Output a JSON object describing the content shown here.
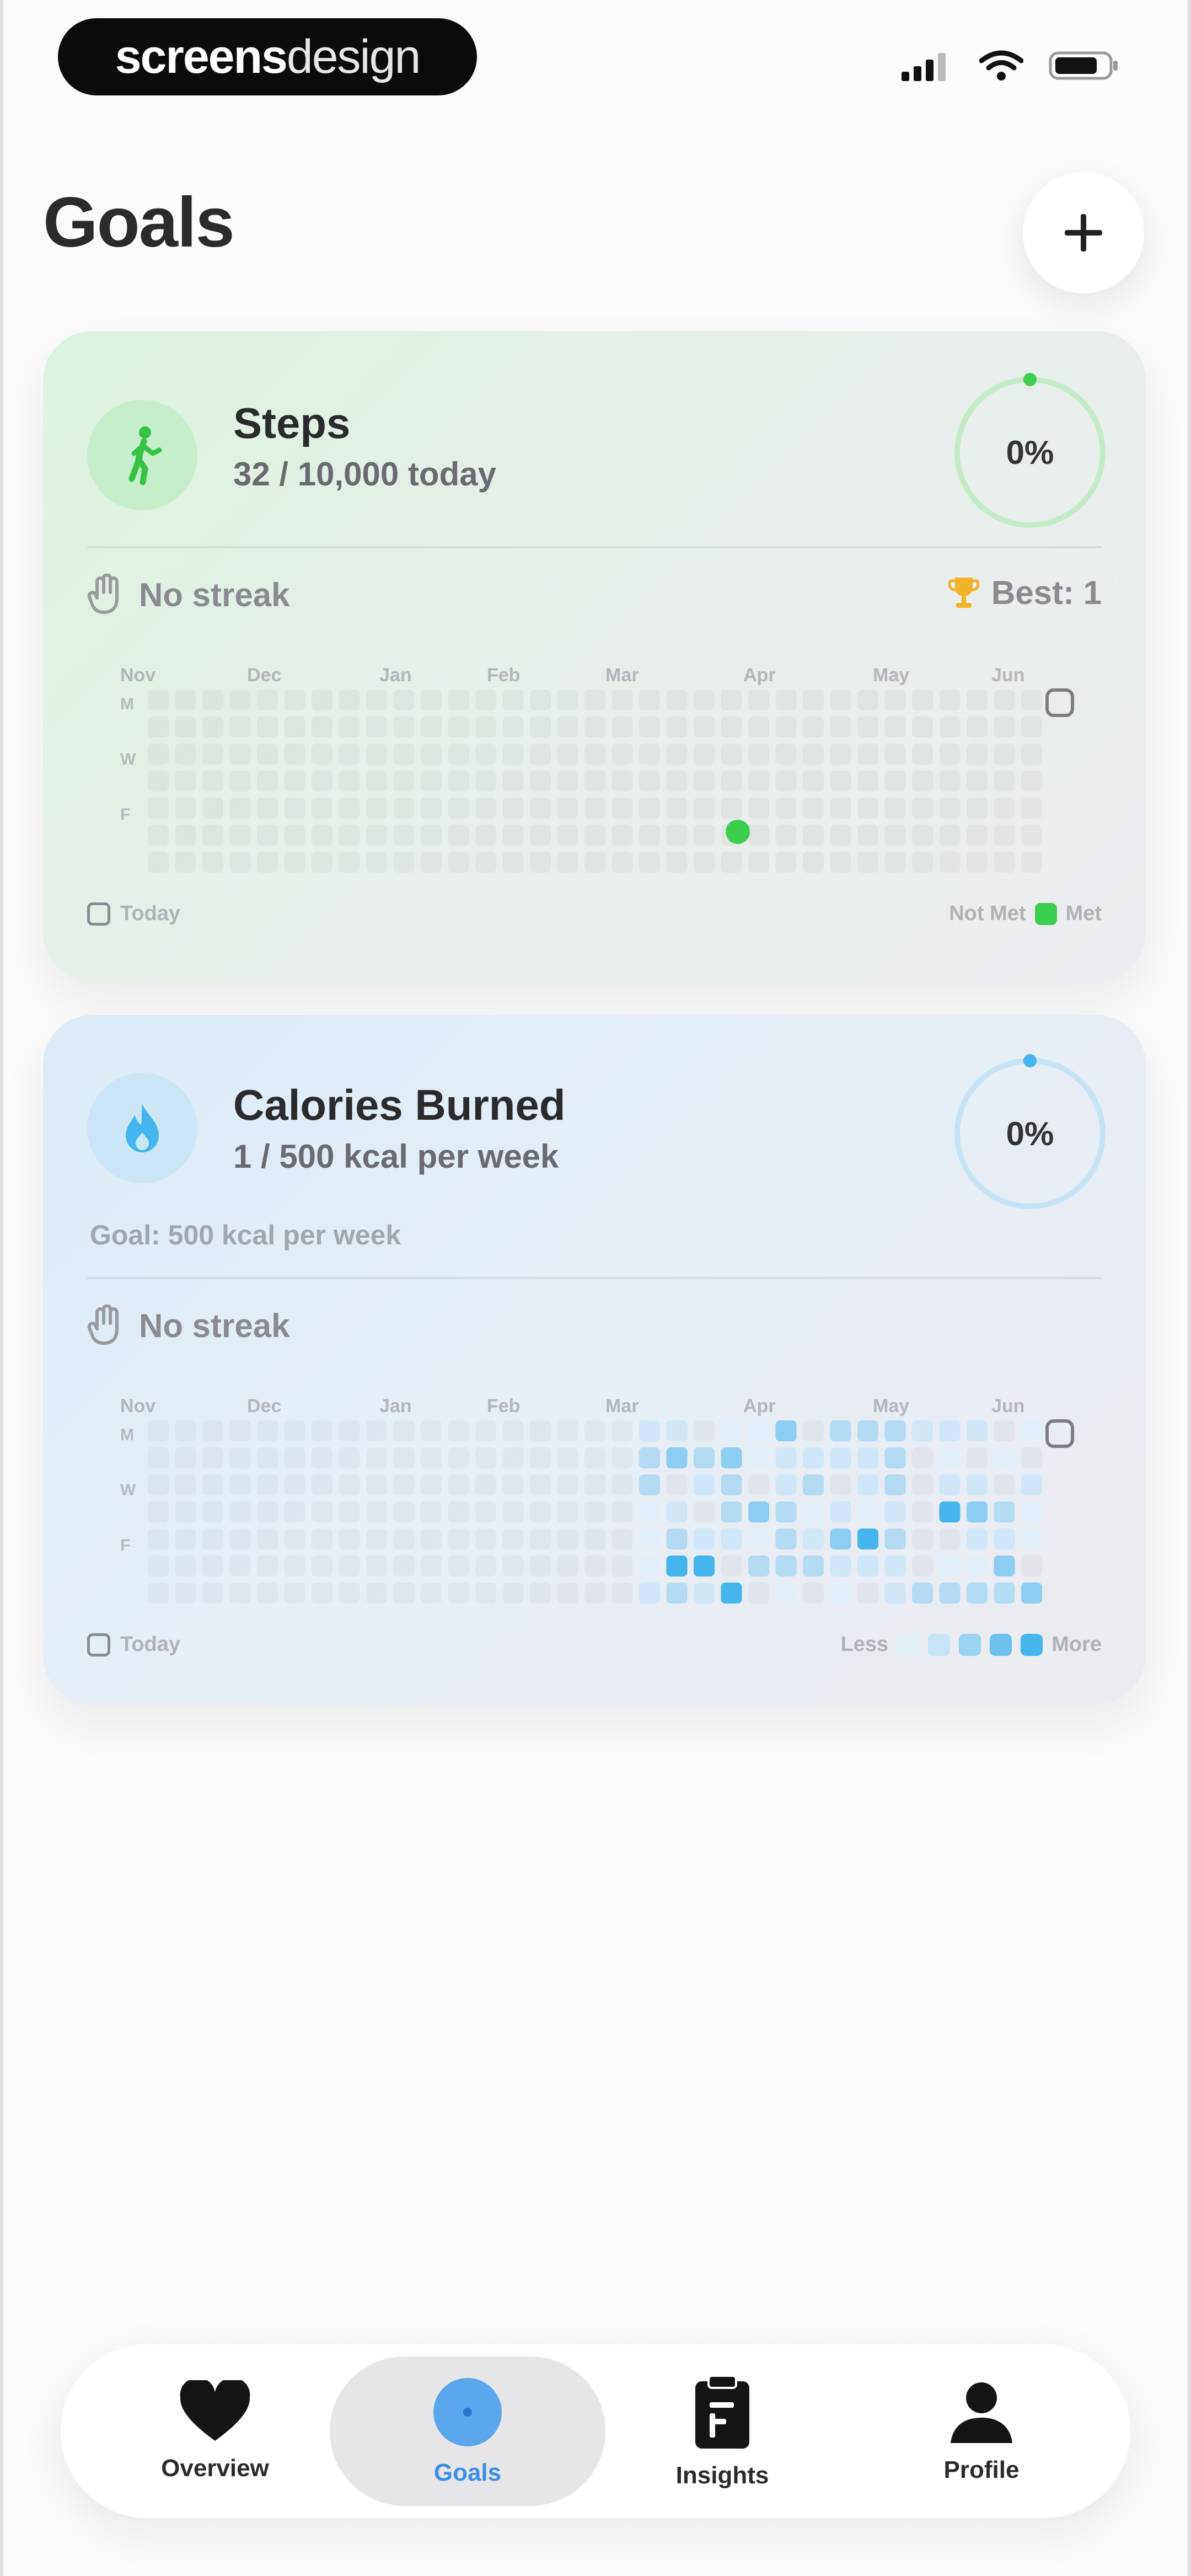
{
  "status_bar": {
    "brand_left": "screens",
    "brand_right": "design"
  },
  "header": {
    "title": "Goals",
    "add_icon": "plus-icon"
  },
  "goals": [
    {
      "title": "Steps",
      "subtitle": "32 / 10,000 today",
      "percent": "0%",
      "progress": 0,
      "icon": "walking-icon",
      "color": "#3ccf4e",
      "streak": "No streak",
      "best": "Best: 1",
      "months": [
        "Nov",
        "Dec",
        "Jan",
        "Feb",
        "Mar",
        "Apr",
        "May",
        "Jun"
      ],
      "day_labels": [
        "M",
        "W",
        "F"
      ],
      "legend_today": "Today",
      "legend_right_a": "Not Met",
      "legend_right_b": "Met"
    },
    {
      "title": "Calories Burned",
      "subtitle": "1 / 500 kcal per week",
      "percent": "0%",
      "progress": 0,
      "icon": "flame-icon",
      "color": "#45b5ee",
      "goal_line": "Goal: 500 kcal per week",
      "streak": "No streak",
      "months": [
        "Nov",
        "Dec",
        "Jan",
        "Feb",
        "Mar",
        "Apr",
        "May",
        "Jun"
      ],
      "day_labels": [
        "M",
        "W",
        "F"
      ],
      "legend_today": "Today",
      "legend_right_a": "Less",
      "legend_right_b": "More"
    }
  ],
  "tabs": [
    {
      "label": "Overview",
      "icon": "heart-icon",
      "active": false
    },
    {
      "label": "Goals",
      "icon": "target-icon",
      "active": true
    },
    {
      "label": "Insights",
      "icon": "clipboard-icon",
      "active": false
    },
    {
      "label": "Profile",
      "icon": "person-icon",
      "active": false
    }
  ]
}
